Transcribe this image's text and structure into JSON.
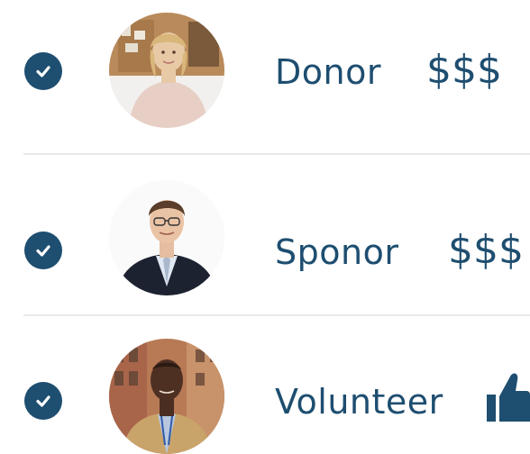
{
  "theme": {
    "accent": "#1e4e70"
  },
  "rows": [
    {
      "check_icon": "check-circle-icon",
      "label": "Donor",
      "tag": "$$$"
    },
    {
      "check_icon": "check-circle-icon",
      "label": "Sponor",
      "tag": "$$$"
    },
    {
      "check_icon": "check-circle-icon",
      "label": "Volunteer",
      "tag_icon": "thumbs-up-icon"
    }
  ]
}
